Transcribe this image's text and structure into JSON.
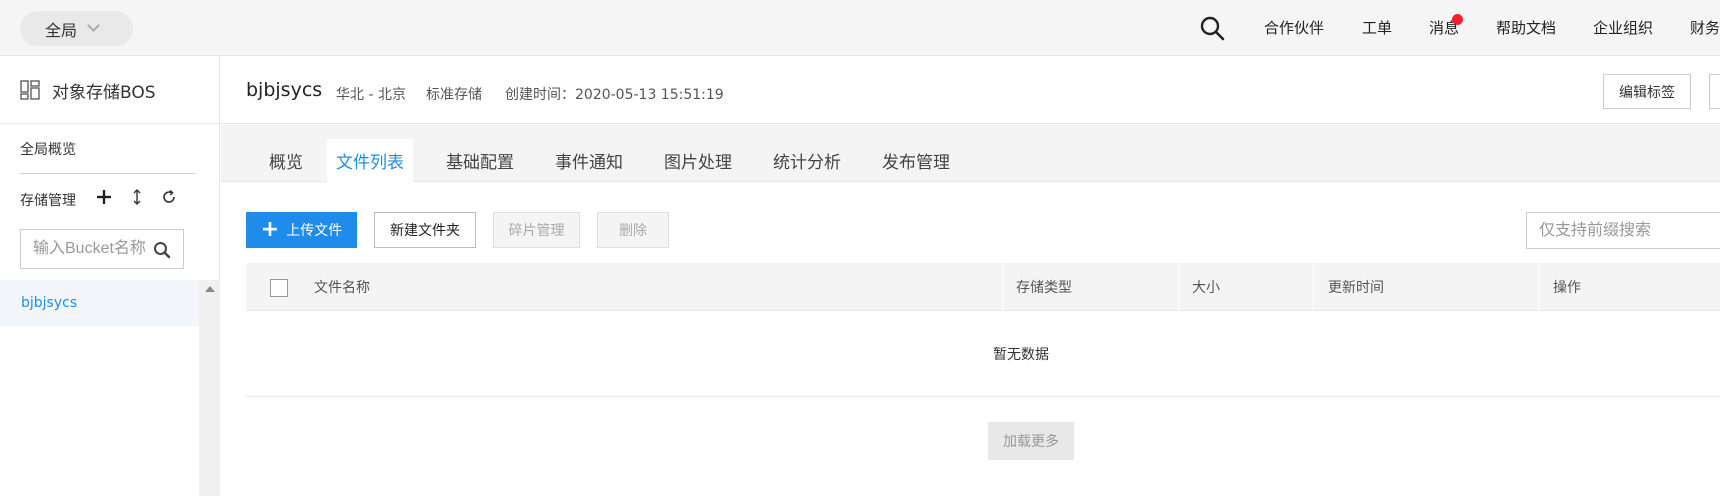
{
  "topbar": {
    "region": "全局",
    "nav": [
      "合作伙伴",
      "工单",
      "消息",
      "帮助文档",
      "企业组织",
      "财务"
    ],
    "badge_color": "#f5222d"
  },
  "sidebar": {
    "title": "对象存储BOS",
    "overview": "全局概览",
    "storage_mgmt": "存储管理",
    "search_placeholder": "输入Bucket名称",
    "buckets": [
      "bjbjsycs"
    ]
  },
  "header": {
    "bucket_name": "bjbjsycs",
    "region": "华北 - 北京",
    "storage_class": "标准存储",
    "created": "创建时间：2020-05-13 15:51:19",
    "edit_tag": "编辑标签"
  },
  "tabs": [
    {
      "label": "概览",
      "active": false
    },
    {
      "label": "文件列表",
      "active": true
    },
    {
      "label": "基础配置",
      "active": false
    },
    {
      "label": "事件通知",
      "active": false
    },
    {
      "label": "图片处理",
      "active": false
    },
    {
      "label": "统计分析",
      "active": false
    },
    {
      "label": "发布管理",
      "active": false
    }
  ],
  "toolbar": {
    "upload": "上传文件",
    "new_folder": "新建文件夹",
    "fragments": "碎片管理",
    "delete": "删除",
    "search_placeholder": "仅支持前缀搜索"
  },
  "table": {
    "columns": [
      "文件名称",
      "存储类型",
      "大小",
      "更新时间",
      "操作"
    ],
    "empty": "暂无数据",
    "load_more": "加载更多"
  },
  "colors": {
    "accent": "#1f8ceb"
  }
}
